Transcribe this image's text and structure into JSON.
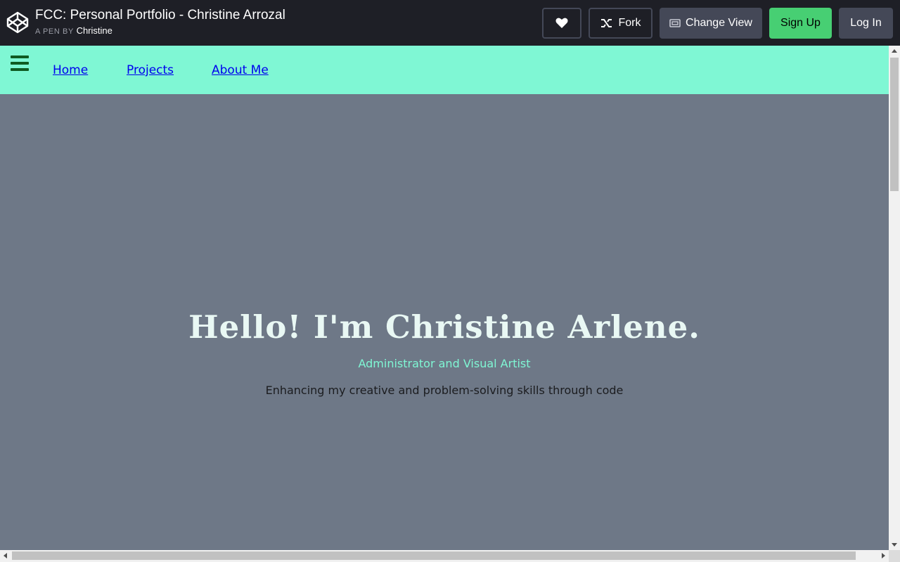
{
  "header": {
    "pen_title": "FCC: Personal Portfolio - Christine Arrozal",
    "by_label": "A PEN BY",
    "author": "Christine",
    "buttons": {
      "fork": "Fork",
      "change_view": "Change View",
      "sign_up": "Sign Up",
      "log_in": "Log In"
    },
    "icons": {
      "logo": "codepen-logo-icon",
      "heart": "heart-icon",
      "fork": "fork-icon",
      "change_view": "change-view-icon"
    }
  },
  "preview": {
    "nav": {
      "menu_icon": "hamburger-menu-icon",
      "links": [
        "Home",
        "Projects",
        "About Me"
      ]
    },
    "hero": {
      "title": "Hello! I'm Christine Arlene.",
      "subtitle": "Administrator and Visual Artist",
      "tagline": "Enhancing my creative and problem-solving skills through code"
    }
  },
  "colors": {
    "topbar_bg": "#1e1f26",
    "nav_bg": "#7ff7d4",
    "page_bg": "#6e7887",
    "signup_green": "#47cf73",
    "subtitle": "#7ff7d4"
  }
}
